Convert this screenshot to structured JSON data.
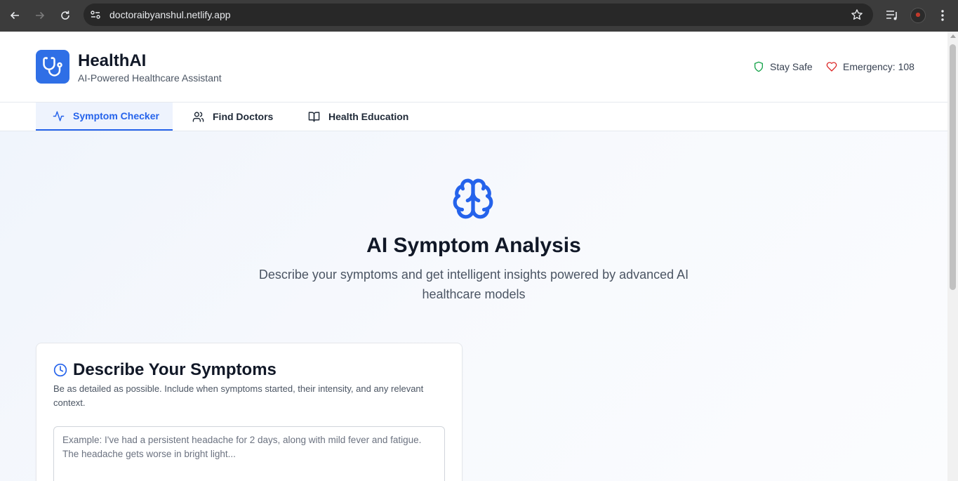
{
  "browser": {
    "url": "doctoraibyanshul.netlify.app"
  },
  "header": {
    "title": "HealthAI",
    "subtitle": "AI-Powered Healthcare Assistant",
    "stay_safe": "Stay Safe",
    "emergency": "Emergency: 108"
  },
  "tabs": [
    {
      "label": "Symptom Checker",
      "icon": "activity-icon",
      "active": true
    },
    {
      "label": "Find Doctors",
      "icon": "users-icon",
      "active": false
    },
    {
      "label": "Health Education",
      "icon": "book-icon",
      "active": false
    }
  ],
  "hero": {
    "icon": "brain-icon",
    "title": "AI Symptom Analysis",
    "description": "Describe your symptoms and get intelligent insights powered by advanced AI healthcare models"
  },
  "symptoms_card": {
    "title": "Describe Your Symptoms",
    "description": "Be as detailed as possible. Include when symptoms started, their intensity, and any relevant context.",
    "placeholder": "Example: I've had a persistent headache for 2 days, along with mild fever and fatigue. The headache gets worse in bright light..."
  },
  "colors": {
    "accent": "#2563eb",
    "logo_bg": "#2f6fe6",
    "stay_safe_icon": "#16a34a",
    "emergency_icon": "#dc2626"
  }
}
